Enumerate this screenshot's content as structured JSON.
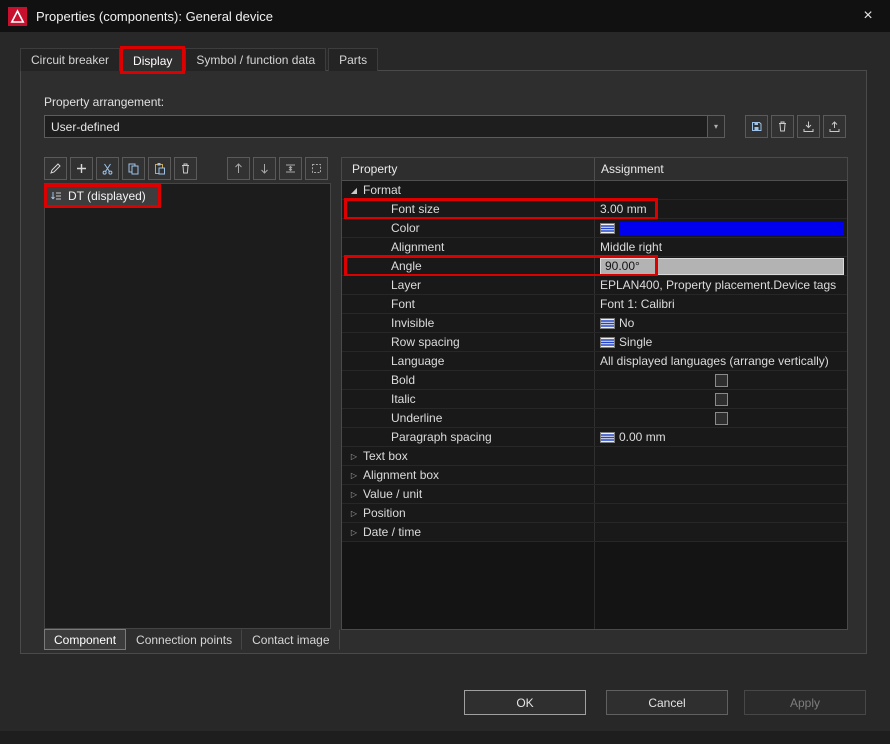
{
  "titlebar": {
    "title": "Properties (components): General device",
    "close_icon": "×"
  },
  "tabs": [
    {
      "label": "Circuit breaker",
      "selected": false,
      "annotated": false
    },
    {
      "label": "Display",
      "selected": true,
      "annotated": true
    },
    {
      "label": "Symbol / function data",
      "selected": false,
      "annotated": false
    },
    {
      "label": "Parts",
      "selected": false,
      "annotated": false
    }
  ],
  "arrangement": {
    "label": "Property arrangement:",
    "value": "User-defined",
    "dropdown_icon": "▼",
    "buttons": [
      "save",
      "delete",
      "import",
      "export"
    ]
  },
  "left_toolbar": {
    "group1": [
      "edit",
      "new",
      "cut",
      "copy",
      "paste",
      "delete"
    ],
    "group2": [
      "move-up",
      "move-down",
      "spacing",
      "frame"
    ]
  },
  "device_list": {
    "items": [
      {
        "label": "DT (displayed)",
        "selected": true,
        "annotated": true
      }
    ]
  },
  "left_tabs": [
    {
      "label": "Component",
      "selected": true
    },
    {
      "label": "Connection points",
      "selected": false
    },
    {
      "label": "Contact image",
      "selected": false
    }
  ],
  "grid": {
    "columns": [
      "Property",
      "Assignment"
    ],
    "expanded_icon": "◢",
    "collapsed_icon": "▷",
    "rows": [
      {
        "label": "Format",
        "type": "group",
        "expanded": true,
        "indent": 0
      },
      {
        "label": "Font size",
        "type": "text",
        "value": "3.00 mm",
        "indent": 1,
        "annotated": true
      },
      {
        "label": "Color",
        "type": "color",
        "indent": 1,
        "icon": true
      },
      {
        "label": "Alignment",
        "type": "text",
        "value": "Middle right",
        "indent": 1
      },
      {
        "label": "Angle",
        "type": "edit",
        "value": "90.00°",
        "indent": 1,
        "annotated": true
      },
      {
        "label": "Layer",
        "type": "text",
        "value": "EPLAN400, Property placement.Device tags",
        "indent": 1
      },
      {
        "label": "Font",
        "type": "text",
        "value": "Font 1: Calibri",
        "indent": 1
      },
      {
        "label": "Invisible",
        "type": "text",
        "value": "No",
        "indent": 1,
        "icon": true
      },
      {
        "label": "Row spacing",
        "type": "text",
        "value": "Single",
        "indent": 1,
        "icon": true
      },
      {
        "label": "Language",
        "type": "text",
        "value": "All displayed languages (arrange vertically)",
        "indent": 1
      },
      {
        "label": "Bold",
        "type": "check",
        "checked": false,
        "indent": 1
      },
      {
        "label": "Italic",
        "type": "check",
        "checked": false,
        "indent": 1
      },
      {
        "label": "Underline",
        "type": "check",
        "checked": false,
        "indent": 1
      },
      {
        "label": "Paragraph spacing",
        "type": "text",
        "value": "0.00 mm",
        "indent": 1,
        "icon": true
      },
      {
        "label": "Text box",
        "type": "group",
        "expanded": false,
        "indent": 0
      },
      {
        "label": "Alignment box",
        "type": "group",
        "expanded": false,
        "indent": 0
      },
      {
        "label": "Value / unit",
        "type": "group",
        "expanded": false,
        "indent": 0
      },
      {
        "label": "Position",
        "type": "group",
        "expanded": false,
        "indent": 0
      },
      {
        "label": "Date / time",
        "type": "group",
        "expanded": false,
        "indent": 0
      }
    ]
  },
  "footer": {
    "ok": "OK",
    "cancel": "Cancel",
    "apply": "Apply"
  },
  "colors": {
    "annotation": "#dc0000",
    "color_value": "#0000ee"
  }
}
